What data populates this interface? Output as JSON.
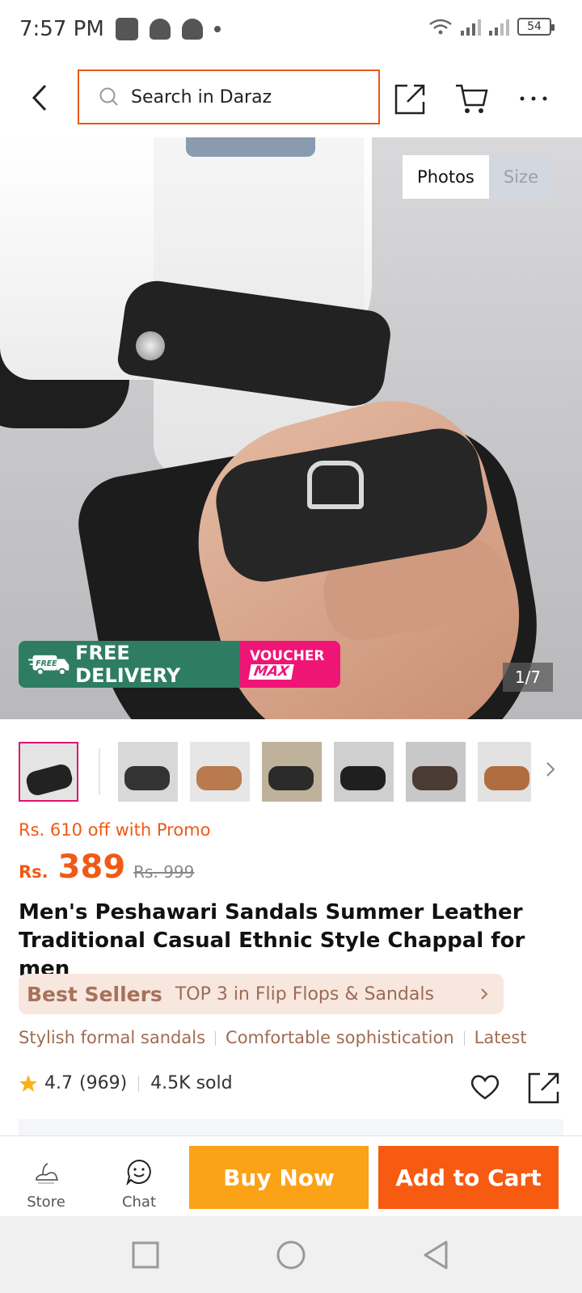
{
  "status_bar": {
    "time": "7:57 PM",
    "battery": "54",
    "icons": [
      "gallery-icon",
      "snapchat-icon",
      "snapchat-icon",
      "dot-icon",
      "wifi-icon",
      "signal-icon",
      "signal-icon",
      "battery-icon"
    ]
  },
  "header": {
    "search_placeholder": "Search in Daraz",
    "icons": [
      "back-icon",
      "search-icon",
      "share-icon",
      "cart-icon",
      "more-icon"
    ]
  },
  "gallery": {
    "tabs": [
      "Photos",
      "Size"
    ],
    "active_tab": "Photos",
    "counter": "1/7",
    "badge_free": "FREE DELIVERY",
    "badge_free_small": "FREE",
    "badge_voucher": "VOUCHER",
    "badge_max": "MAX"
  },
  "price": {
    "promo": "Rs. 610 off with Promo",
    "currency": "Rs.",
    "current": "389",
    "original": "Rs. 999",
    "accent_color": "#f05a16"
  },
  "product": {
    "title": "Men's Peshawari Sandals Summer Leather Traditional Casual Ethnic Style Chappal for men"
  },
  "bestseller": {
    "logo": "Best Sellers",
    "text": "TOP 3 in Flip Flops & Sandals"
  },
  "tags": [
    "Stylish formal sandals",
    "Comfortable sophistication",
    "Latest"
  ],
  "rating": {
    "score": "4.7",
    "count": "(969)",
    "sold": "4.5K sold"
  },
  "action_bar": {
    "store_label": "Store",
    "chat_label": "Chat",
    "buy_now": "Buy Now",
    "add_to_cart": "Add to Cart",
    "buy_color": "#fba216",
    "cart_color": "#f75a11"
  },
  "nav": {
    "icons": [
      "recent-apps-icon",
      "home-icon",
      "back-nav-icon"
    ]
  }
}
